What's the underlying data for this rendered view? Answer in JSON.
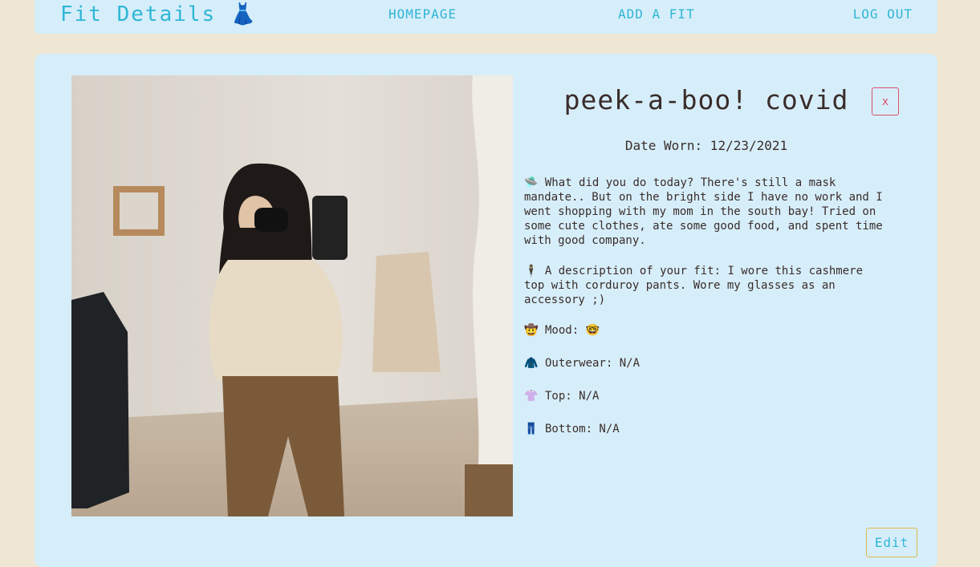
{
  "nav": {
    "brand": "Fit Details 👗",
    "links": [
      "HOMEPAGE",
      "ADD A FIT",
      "LOG OUT"
    ]
  },
  "fit": {
    "title": "peek-a-boo! covid",
    "close_label": "x",
    "date_worn": "Date Worn: 12/23/2021",
    "today_emoji": "🛸",
    "today": "What did you do today? There's still a mask mandate.. But on the bright side I have no work and I went shopping with my mom in the south bay! Tried on some cute clothes, ate some good food, and spent time with good company.",
    "desc_emoji": "🕴",
    "description": "A description of your fit: I wore this cashmere top with corduroy pants. Wore my glasses as an accessory ;)",
    "mood_emoji": "🤠",
    "mood": "Mood: 🤓",
    "outer_emoji": "🧥",
    "outerwear": "Outerwear: N/A",
    "top_emoji": "👚",
    "top": "Top: N/A",
    "bottom_emoji": "👖",
    "bottom": "Bottom: N/A",
    "edit_label": "Edit"
  }
}
